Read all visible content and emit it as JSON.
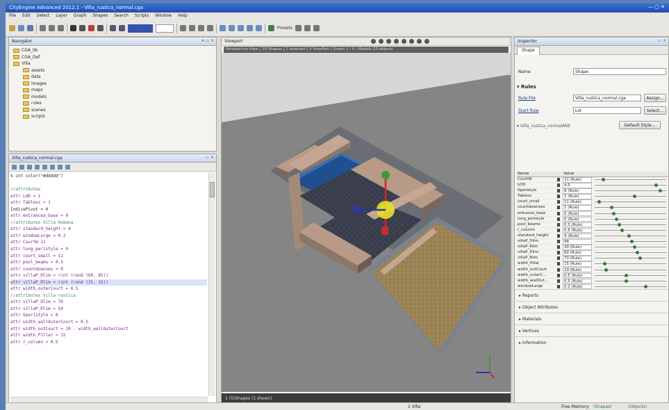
{
  "window": {
    "title": "CityEngine Advanced 2012.1 - Villa_rustica_normal.cga"
  },
  "menu": [
    "File",
    "Edit",
    "Select",
    "Layer",
    "Graph",
    "Shapes",
    "Search",
    "Scripts",
    "Window",
    "Help"
  ],
  "toolbar": {
    "selector_value": "",
    "presets_label": "Presets"
  },
  "navigator": {
    "title": "Navigator",
    "tree": [
      {
        "label": "CGA_lib",
        "level": 0
      },
      {
        "label": "CGA_Def",
        "level": 0
      },
      {
        "label": "Villa",
        "level": 0
      },
      {
        "label": "assets",
        "level": 1
      },
      {
        "label": "data",
        "level": 1
      },
      {
        "label": "images",
        "level": 1
      },
      {
        "label": "maps",
        "level": 1
      },
      {
        "label": "models",
        "level": 1
      },
      {
        "label": "rules",
        "level": 1
      },
      {
        "label": "scenes",
        "level": 1
      },
      {
        "label": "scripts",
        "level": 1
      }
    ]
  },
  "editor": {
    "title": "Villa_rustica_normal.cga",
    "lines": [
      {
        "t": "% cnt color(\"#ddddd\")",
        "c": "plain"
      },
      {
        "t": "",
        "c": "plain"
      },
      {
        "t": "//attributes",
        "c": "cm"
      },
      {
        "t": "attr LOD = 1",
        "c": "attr"
      },
      {
        "t": "attr Tabless = 1",
        "c": "attr"
      },
      {
        "t": "IndicePivot = 0",
        "c": "plain"
      },
      {
        "t": "attr entrancea_base = 0",
        "c": "attr"
      },
      {
        "t": "//attributes Villa Romana",
        "c": "cm"
      },
      {
        "t": "attr standard_height = 4",
        "c": "attr"
      },
      {
        "t": "attr windowLarge = 0.2",
        "c": "attr"
      },
      {
        "t": "attr CourtW 11",
        "c": "attr"
      },
      {
        "t": "attr long_peristyle = 0",
        "c": "attr"
      },
      {
        "t": "attr court_small = 11",
        "c": "attr"
      },
      {
        "t": "attr pool_beams = 0.3",
        "c": "attr"
      },
      {
        "t": "attr countdownses = 0",
        "c": "attr"
      },
      {
        "t": "attr villaP_Dlim = rint (rand (60, 85))",
        "c": "attr"
      },
      {
        "t": "attr villaP_Rlim = rint (rand (35, 15))",
        "c": "attr-hl"
      },
      {
        "t": "attr width_outerCourt = 0.5",
        "c": "attr"
      },
      {
        "t": "//attributes Villa rustica",
        "c": "cm"
      },
      {
        "t": "attr villaP_Dlim = 70",
        "c": "attr"
      },
      {
        "t": "attr villaP_Rlim = 50",
        "c": "attr"
      },
      {
        "t": "attr Speristyle = 8",
        "c": "attr"
      },
      {
        "t": "attr width_wallOuterCourt = 0.5",
        "c": "attr"
      },
      {
        "t": "attr width_outCourt = 20 - width_wallOuterCourt",
        "c": "attr"
      },
      {
        "t": "attr width_Pillar = 15",
        "c": "attr"
      },
      {
        "t": "attr r_column = 0.5",
        "c": "attr"
      }
    ]
  },
  "viewport": {
    "title": "Viewport",
    "info": "Perspective View | 19 Shapes | 1 selected | 3 ViewPort | Graph 1 / 0 | Models 23 objects",
    "status": "1 (S)Shapes (1 shown)"
  },
  "inspector": {
    "title": "Inspector",
    "tab": "Shape",
    "name_label": "Name",
    "name_value": "Shape",
    "rules_section": "Rules",
    "rule_file_label": "Rule File",
    "rule_file_value": "Villa_rustica_normal.cga",
    "start_rule_label": "Start Rule",
    "start_rule_value": "Lot",
    "assign_label": "Assign...",
    "select_label": "Select...",
    "subsection": "Villa_rustica_normalARE",
    "default_style_label": "Default Style...",
    "table_name_header": "Name",
    "table_value_header": "Value",
    "attributes": [
      {
        "name": "CourtW",
        "value": "11 (Rule)",
        "knob": 0.1
      },
      {
        "name": "LOD",
        "value": "4.0",
        "knob": 0.88
      },
      {
        "name": "Speristyle",
        "value": "8 (Rule)",
        "knob": 0.94
      },
      {
        "name": "Tabless",
        "value": "1 (Rule)",
        "knob": 0.56
      },
      {
        "name": "court_small",
        "value": "11 (Rule)",
        "knob": 0.04
      },
      {
        "name": "countdownses",
        "value": "1 (Rule)",
        "knob": 0.22
      },
      {
        "name": "entrance_base",
        "value": "0 (Rule)",
        "knob": 0.26
      },
      {
        "name": "long_peristyle",
        "value": "0 (Rule)",
        "knob": 0.3
      },
      {
        "name": "pool_beams",
        "value": "0.3 (Rule)",
        "knob": 0.34
      },
      {
        "name": "r_column",
        "value": "0.5 (Rule)",
        "knob": 0.38
      },
      {
        "name": "standard_height",
        "value": "4 (Rule)",
        "knob": 0.48
      },
      {
        "name": "villaP_Dlim",
        "value": "98",
        "knob": 0.52
      },
      {
        "name": "villaP_Rlim",
        "value": "30 (Rule)",
        "knob": 0.56
      },
      {
        "name": "villaP_Dlim",
        "value": "60 (Rule)",
        "knob": 0.6
      },
      {
        "name": "villaP_Rlim",
        "value": "70 (Rule)",
        "knob": 0.64
      },
      {
        "name": "width_Pillar",
        "value": "15 (Rule)",
        "knob": 0.12
      },
      {
        "name": "width_outCourt",
        "value": "19 (Rule)",
        "knob": 0.14
      },
      {
        "name": "width_outerC...",
        "value": "0.5 (Rule)",
        "knob": 0.44
      },
      {
        "name": "width_wallOut...",
        "value": "0.5 (Rule)",
        "knob": 0.44
      },
      {
        "name": "windowLarge",
        "value": "0.2 (Rule)",
        "knob": 0.72
      }
    ],
    "collapsibles": [
      "Reports",
      "Object Attributes",
      "Materials",
      "Vertices",
      "Information"
    ]
  },
  "statusbar": {
    "center": "1 Villa",
    "memory": "Free Memory:",
    "right1": "(Shapes)",
    "right2": "(Objects)"
  },
  "colors": {
    "accent": "#3a6fd0",
    "knob": "#3a7a3a",
    "ground": "#9c8456",
    "wall": "#b89a86"
  }
}
